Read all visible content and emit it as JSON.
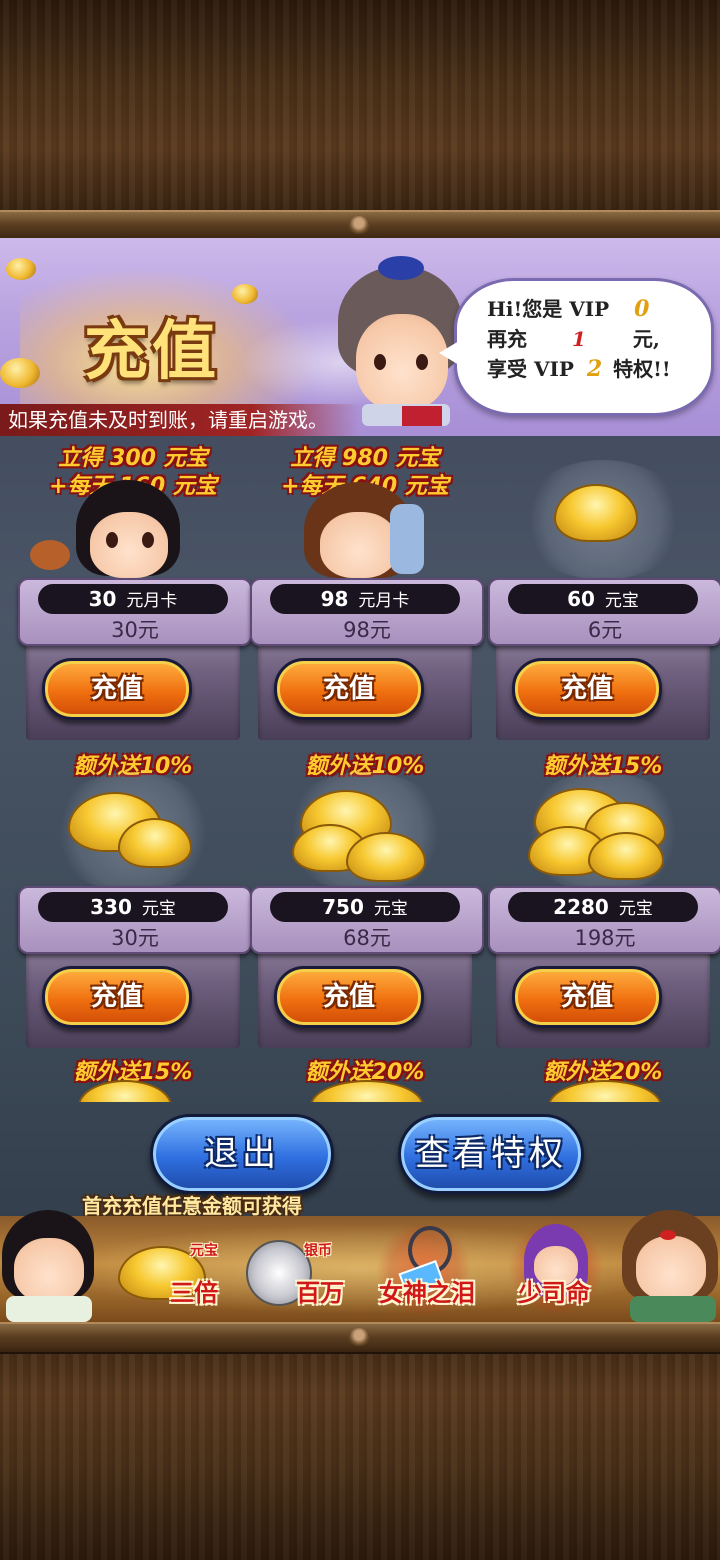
{
  "banner": {
    "title": "充值",
    "notice": "如果充值未及时到账，请重启游戏。",
    "speech": {
      "line1_prefix": "Hi!您是 VIP",
      "vip_current": "0",
      "line2_prefix": "再充",
      "amount_needed": "1",
      "line2_suffix": "元,",
      "line3_prefix": "享受 VIP",
      "vip_next": "2",
      "line3_suffix": "特权!!"
    }
  },
  "shop": {
    "button_label": "充值",
    "items": [
      {
        "bonus1": "立得 300 元宝",
        "bonus2": "+每天 160 元宝",
        "amount": "30",
        "unit": "元月卡",
        "price": "30元"
      },
      {
        "bonus1": "立得 980 元宝",
        "bonus2": "+每天 640 元宝",
        "amount": "98",
        "unit": "元月卡",
        "price": "98元"
      },
      {
        "bonus1": "",
        "bonus2": "",
        "amount": "60",
        "unit": "元宝",
        "price": "6元"
      },
      {
        "bonus1": "额外送10%",
        "bonus2": "",
        "amount": "330",
        "unit": "元宝",
        "price": "30元"
      },
      {
        "bonus1": "额外送10%",
        "bonus2": "",
        "amount": "750",
        "unit": "元宝",
        "price": "68元"
      },
      {
        "bonus1": "额外送15%",
        "bonus2": "",
        "amount": "2280",
        "unit": "元宝",
        "price": "198元"
      },
      {
        "bonus1": "额外送15%",
        "bonus2": ""
      },
      {
        "bonus1": "额外送20%",
        "bonus2": ""
      },
      {
        "bonus1": "额外送20%",
        "bonus2": ""
      }
    ]
  },
  "actions": {
    "exit_label": "退出",
    "privileges_label": "查看特权"
  },
  "first_charge": {
    "title": "首充充值任意金额可获得",
    "rewards": [
      {
        "small": "元宝",
        "name": "三倍"
      },
      {
        "small": "银币",
        "name": "百万"
      },
      {
        "small": "",
        "name": "女神之泪"
      },
      {
        "small": "",
        "name": "少司命"
      }
    ]
  },
  "colors": {
    "accent_gold": "#ffcc30",
    "button_orange": "#f07010",
    "button_blue": "#2f6fe0",
    "reward_red": "#d01818"
  },
  "icons": [
    "gold-ingot-icon",
    "silver-coin-icon",
    "necklace-icon",
    "hero-portrait-icon",
    "chicken-leg-icon"
  ]
}
